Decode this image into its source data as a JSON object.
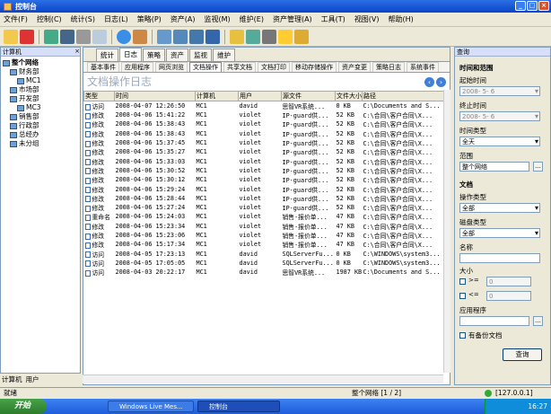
{
  "window": {
    "title": "控制台"
  },
  "menu": [
    "文件(F)",
    "控制(C)",
    "统计(S)",
    "日志(L)",
    "策略(P)",
    "资产(A)",
    "监视(M)",
    "维护(E)",
    "资产管理(A)",
    "工具(T)",
    "视图(V)",
    "帮助(H)"
  ],
  "left_panel": {
    "header": "计算机",
    "tree": [
      {
        "label": "整个网络",
        "level": 0,
        "bold": true
      },
      {
        "label": "财务部",
        "level": 1
      },
      {
        "label": "MC1",
        "level": 2
      },
      {
        "label": "市场部",
        "level": 1
      },
      {
        "label": "开发部",
        "level": 1
      },
      {
        "label": "MC3",
        "level": 2
      },
      {
        "label": "销售部",
        "level": 1
      },
      {
        "label": "行政部",
        "level": 1
      },
      {
        "label": "总经办",
        "level": 1
      },
      {
        "label": "未分组",
        "level": 1
      }
    ],
    "tabs": [
      "计算机",
      "用户"
    ]
  },
  "main_tabs": [
    "统计",
    "日志",
    "策略",
    "资产",
    "监视",
    "维护"
  ],
  "main_active_tab": "日志",
  "sub_tabs": [
    "基本事件",
    "应用程序",
    "网页浏览",
    "文档操作",
    "共享文档",
    "文档打印",
    "移动存储操作",
    "资产变更",
    "策略日志",
    "系统事件"
  ],
  "sub_active_tab": "文档操作",
  "page_title": "文档操作日志",
  "table": {
    "columns": [
      "类型",
      "时间",
      "计算机",
      "用户",
      "源文件",
      "文件大小",
      "路径"
    ],
    "rows": [
      [
        "访问",
        "2008-04-07 12:26:50",
        "MC1",
        "david",
        "思智VR系统...",
        "0 KB",
        "C:\\Documents and S..."
      ],
      [
        "修改",
        "2008-04-06 15:41:22",
        "MC1",
        "violet",
        "IP-guard供...",
        "52 KB",
        "C:\\合同\\客户合同\\X..."
      ],
      [
        "修改",
        "2008-04-06 15:38:43",
        "MC1",
        "violet",
        "IP-guard供...",
        "52 KB",
        "C:\\合同\\客户合同\\X..."
      ],
      [
        "修改",
        "2008-04-06 15:38:43",
        "MC1",
        "violet",
        "IP-guard供...",
        "52 KB",
        "C:\\合同\\客户合同\\X..."
      ],
      [
        "修改",
        "2008-04-06 15:37:45",
        "MC1",
        "violet",
        "IP-guard供...",
        "52 KB",
        "C:\\合同\\客户合同\\X..."
      ],
      [
        "修改",
        "2008-04-06 15:35:27",
        "MC1",
        "violet",
        "IP-guard供...",
        "52 KB",
        "C:\\合同\\客户合同\\X..."
      ],
      [
        "修改",
        "2008-04-06 15:33:03",
        "MC1",
        "violet",
        "IP-guard供...",
        "52 KB",
        "C:\\合同\\客户合同\\X..."
      ],
      [
        "修改",
        "2008-04-06 15:30:52",
        "MC1",
        "violet",
        "IP-guard供...",
        "52 KB",
        "C:\\合同\\客户合同\\X..."
      ],
      [
        "修改",
        "2008-04-06 15:30:12",
        "MC1",
        "violet",
        "IP-guard供...",
        "52 KB",
        "C:\\合同\\客户合同\\X..."
      ],
      [
        "修改",
        "2008-04-06 15:29:24",
        "MC1",
        "violet",
        "IP-guard供...",
        "52 KB",
        "C:\\合同\\客户合同\\X..."
      ],
      [
        "修改",
        "2008-04-06 15:28:44",
        "MC1",
        "violet",
        "IP-guard供...",
        "52 KB",
        "C:\\合同\\客户合同\\X..."
      ],
      [
        "修改",
        "2008-04-06 15:27:24",
        "MC1",
        "violet",
        "IP-guard供...",
        "52 KB",
        "C:\\合同\\客户合同\\X..."
      ],
      [
        "重命名",
        "2008-04-06 15:24:03",
        "MC1",
        "violet",
        "销售-报价单...",
        "47 KB",
        "C:\\合同\\客户合同\\X..."
      ],
      [
        "修改",
        "2008-04-06 15:23:34",
        "MC1",
        "violet",
        "销售-报价单...",
        "47 KB",
        "C:\\合同\\客户合同\\X..."
      ],
      [
        "修改",
        "2008-04-06 15:23:06",
        "MC1",
        "violet",
        "销售-报价单...",
        "47 KB",
        "C:\\合同\\客户合同\\X..."
      ],
      [
        "修改",
        "2008-04-06 15:17:34",
        "MC1",
        "violet",
        "销售-报价单...",
        "47 KB",
        "C:\\合同\\客户合同\\X..."
      ],
      [
        "访问",
        "2008-04-05 17:23:13",
        "MC1",
        "david",
        "SQLServerFu...",
        "0 KB",
        "C:\\WINDOWS\\system3..."
      ],
      [
        "访问",
        "2008-04-05 17:05:05",
        "MC1",
        "david",
        "SQLServerFu...",
        "0 KB",
        "C:\\WINDOWS\\system3..."
      ],
      [
        "访问",
        "2008-04-03 20:22:17",
        "MC1",
        "david",
        "思智VR系统...",
        "1987 KB",
        "C:\\Documents and S..."
      ]
    ]
  },
  "right_panel": {
    "header": "查询",
    "section_time": "时间和范围",
    "start_time_label": "起始时间",
    "start_time_value": "2008- 5- 6",
    "end_time_label": "终止时间",
    "end_time_value": "2008- 5- 6",
    "time_type_label": "时间类型",
    "time_type_value": "全天",
    "range_label": "范围",
    "range_value": "整个网络",
    "section_doc": "文档",
    "op_type_label": "操作类型",
    "op_type_value": "全部",
    "disk_type_label": "磁盘类型",
    "disk_type_value": "全部",
    "name_label": "名称",
    "size_label": "大小",
    "size_ge": ">=",
    "size_le": "<=",
    "size_ge_value": "0",
    "size_le_value": "0",
    "app_label": "应用程序",
    "backup_label": "有备份文档",
    "search_button": "查询"
  },
  "status": {
    "left": "就绪",
    "page": "整个网络 [1 / 2]",
    "ip": "[127.0.0.1]"
  },
  "taskbar": {
    "start": "开始",
    "tasks": [
      "Windows Live Mes...",
      "控制台"
    ],
    "clock": "16:27"
  }
}
